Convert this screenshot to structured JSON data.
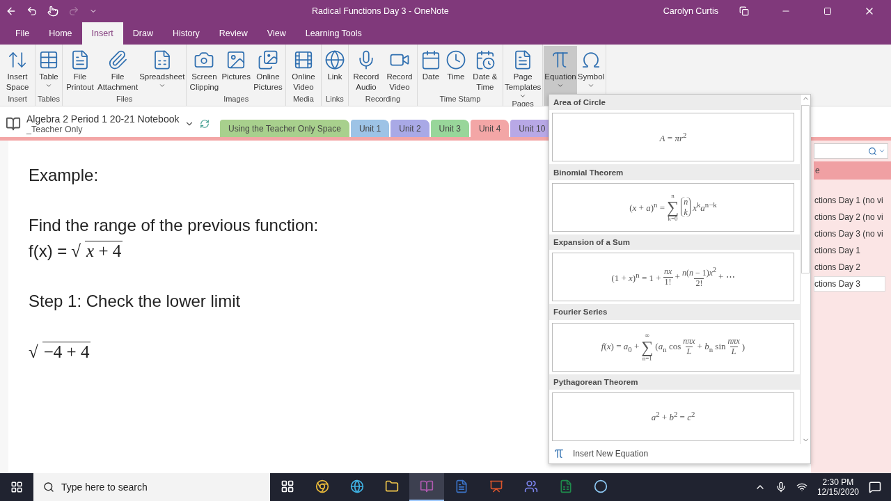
{
  "title_bar": {
    "title": "Radical Functions Day 3  -  OneNote",
    "user": "Carolyn Curtis",
    "redo_disabled": true
  },
  "menu_tabs": [
    {
      "label": "File",
      "selected": false
    },
    {
      "label": "Home",
      "selected": false
    },
    {
      "label": "Insert",
      "selected": true
    },
    {
      "label": "Draw",
      "selected": false
    },
    {
      "label": "History",
      "selected": false
    },
    {
      "label": "Review",
      "selected": false
    },
    {
      "label": "View",
      "selected": false
    },
    {
      "label": "Learning Tools",
      "selected": false
    }
  ],
  "ribbon": {
    "groups": [
      {
        "label": "Insert",
        "buttons": [
          {
            "label": "Insert Space",
            "dropdown": false,
            "selected": false
          }
        ]
      },
      {
        "label": "Tables",
        "buttons": [
          {
            "label": "Table",
            "dropdown": true,
            "selected": false
          }
        ]
      },
      {
        "label": "Files",
        "buttons": [
          {
            "label": "File Printout",
            "dropdown": false,
            "selected": false
          },
          {
            "label": "File Attachment",
            "dropdown": false,
            "selected": false
          },
          {
            "label": "Spreadsheet",
            "dropdown": true,
            "selected": false
          }
        ]
      },
      {
        "label": "Images",
        "buttons": [
          {
            "label": "Screen Clipping",
            "dropdown": false,
            "selected": false
          },
          {
            "label": "Pictures",
            "dropdown": false,
            "selected": false
          },
          {
            "label": "Online Pictures",
            "dropdown": false,
            "selected": false
          }
        ]
      },
      {
        "label": "Media",
        "buttons": [
          {
            "label": "Online Video",
            "dropdown": false,
            "selected": false
          }
        ]
      },
      {
        "label": "Links",
        "buttons": [
          {
            "label": "Link",
            "dropdown": false,
            "selected": false
          }
        ]
      },
      {
        "label": "Recording",
        "buttons": [
          {
            "label": "Record Audio",
            "dropdown": false,
            "selected": false
          },
          {
            "label": "Record Video",
            "dropdown": false,
            "selected": false
          }
        ]
      },
      {
        "label": "Time Stamp",
        "buttons": [
          {
            "label": "Date",
            "dropdown": false,
            "selected": false
          },
          {
            "label": "Time",
            "dropdown": false,
            "selected": false
          },
          {
            "label": "Date & Time",
            "dropdown": false,
            "selected": false
          }
        ]
      },
      {
        "label": "Pages",
        "buttons": [
          {
            "label": "Page Templates",
            "dropdown": true,
            "selected": false
          }
        ]
      },
      {
        "buttons": [
          {
            "label": "Equation",
            "dropdown": true,
            "selected": true
          },
          {
            "label": "Symbol",
            "dropdown": true,
            "selected": false
          }
        ]
      }
    ]
  },
  "notebook": {
    "name": "Algebra 2 Period 1 20-21 Notebook",
    "section_group": "_Teacher Only",
    "sections": [
      {
        "label": "Using the Teacher Only Space",
        "color": "#a8d08d"
      },
      {
        "label": "Unit 1",
        "color": "#9dc3e6"
      },
      {
        "label": "Unit 2",
        "color": "#a9a9e6"
      },
      {
        "label": "Unit 3",
        "color": "#98d69a"
      },
      {
        "label": "Unit 4",
        "color": "#f3a6a6"
      },
      {
        "label": "Unit 10",
        "color": "#b8a8e6"
      }
    ]
  },
  "page": {
    "lines": [
      {
        "kind": "text",
        "text": "Example:"
      },
      {
        "kind": "text",
        "text": "Find the range of the previous function:"
      },
      {
        "kind": "formula",
        "prefix": "f(x) =",
        "sign": "√",
        "radicand": "*x* + 4"
      },
      {
        "kind": "text",
        "text": "Step 1: Check the lower limit"
      },
      {
        "kind": "formula",
        "sign": "√",
        "radicand": "−4 + 4"
      }
    ]
  },
  "equation_menu": {
    "items": [
      {
        "name": "Area of Circle",
        "parts": [
          {
            "kind": "text",
            "text": "*A* = *πr*$^{2}$"
          }
        ]
      },
      {
        "name": "Binomial Theorem",
        "parts": [
          {
            "kind": "text",
            "text": "(*x* + *a*)$^{n}$ ="
          },
          {
            "kind": "sum",
            "sign": "∑",
            "over": "n",
            "under": "k=0"
          },
          {
            "kind": "binom",
            "top": "n",
            "bottom": "k"
          },
          {
            "kind": "text",
            "text": "*x*$^{k}$*a*$^{n−k}$"
          }
        ]
      },
      {
        "name": "Expansion of a Sum",
        "parts": [
          {
            "kind": "text",
            "text": "(1 + *x*)$^{n}$ = 1 +"
          },
          {
            "kind": "frac",
            "num": "*nx*",
            "den": "1!"
          },
          {
            "kind": "text",
            "text": "+"
          },
          {
            "kind": "frac",
            "num": "*n*(*n* − 1)*x*$^{2}$",
            "den": "2!"
          },
          {
            "kind": "text",
            "text": "+ ⋯"
          }
        ]
      },
      {
        "name": "Fourier Series",
        "parts": [
          {
            "kind": "text",
            "text": "*f*(*x*) = *a*$_{0}$ +"
          },
          {
            "kind": "sum",
            "sign": "∑",
            "over": "∞",
            "under": "n=1"
          },
          {
            "kind": "text",
            "text": "(*a*$_{n}$ cos"
          },
          {
            "kind": "frac",
            "num": "*nπx*",
            "den": "*L*"
          },
          {
            "kind": "text",
            "text": "+ *b*$_{n}$ sin"
          },
          {
            "kind": "frac",
            "num": "*nπx*",
            "den": "*L*"
          },
          {
            "kind": "text",
            "text": ")"
          }
        ]
      },
      {
        "name": "Pythagorean Theorem",
        "parts": [
          {
            "kind": "text",
            "text": "*a*$^{2}$ + *b*$^{2}$ = *c*$^{2}$"
          }
        ]
      }
    ],
    "footer": "Insert New Equation"
  },
  "pages_panel": {
    "section": "e",
    "pages": [
      {
        "title": "ctions Day 1 (no vi",
        "selected": false
      },
      {
        "title": "ctions Day 2 (no vi",
        "selected": false
      },
      {
        "title": "ctions Day 3 (no vi",
        "selected": false
      },
      {
        "title": "ctions Day 1",
        "selected": false
      },
      {
        "title": "ctions Day 2",
        "selected": false
      },
      {
        "title": "ctions Day 3",
        "selected": true
      }
    ]
  },
  "taskbar": {
    "search_placeholder": "Type here to search",
    "time": "2:30 PM",
    "date": "12/15/2020",
    "apps": [
      {
        "selected": false
      },
      {
        "selected": false
      },
      {
        "selected": false
      },
      {
        "selected": false
      },
      {
        "selected": true
      },
      {
        "selected": false
      },
      {
        "selected": false
      },
      {
        "selected": false
      },
      {
        "selected": false
      },
      {
        "selected": false
      }
    ]
  }
}
